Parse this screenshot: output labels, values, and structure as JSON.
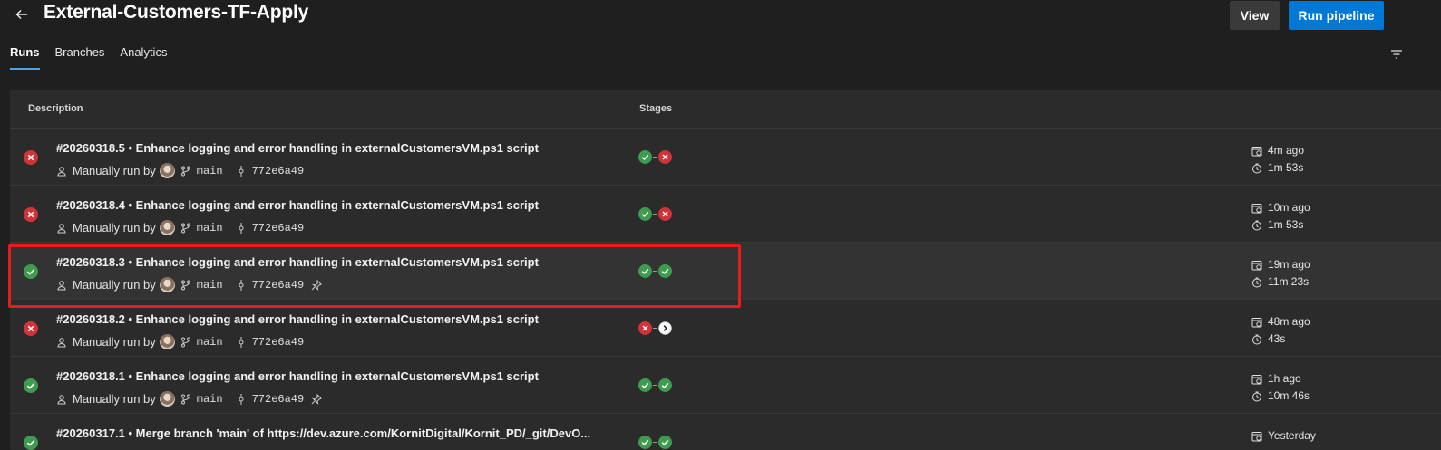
{
  "header": {
    "title": "External-Customers-TF-Apply",
    "view_label": "View",
    "run_label": "Run pipeline"
  },
  "tabs": [
    {
      "label": "Runs"
    },
    {
      "label": "Branches"
    },
    {
      "label": "Analytics"
    }
  ],
  "table": {
    "col_description": "Description",
    "col_stages": "Stages"
  },
  "runs": [
    {
      "status": "failed",
      "description": "#20260318.5 • Enhance logging and error handling in externalCustomersVM.ps1 script",
      "trigger": "Manually run by",
      "branch": "main",
      "commit": "772e6a49",
      "pinned": false,
      "stages": [
        "success",
        "failed"
      ],
      "started": "4m ago",
      "duration": "1m 53s"
    },
    {
      "status": "failed",
      "description": "#20260318.4 • Enhance logging and error handling in externalCustomersVM.ps1 script",
      "trigger": "Manually run by",
      "branch": "main",
      "commit": "772e6a49",
      "pinned": false,
      "stages": [
        "success",
        "failed"
      ],
      "started": "10m ago",
      "duration": "1m 53s"
    },
    {
      "status": "success",
      "description": "#20260318.3 • Enhance logging and error handling in externalCustomersVM.ps1 script",
      "trigger": "Manually run by",
      "branch": "main",
      "commit": "772e6a49",
      "pinned": true,
      "stages": [
        "success",
        "success"
      ],
      "started": "19m ago",
      "duration": "11m 23s"
    },
    {
      "status": "failed",
      "description": "#20260318.2 • Enhance logging and error handling in externalCustomersVM.ps1 script",
      "trigger": "Manually run by",
      "branch": "main",
      "commit": "772e6a49",
      "pinned": false,
      "stages": [
        "failed",
        "skipped"
      ],
      "started": "48m ago",
      "duration": "43s"
    },
    {
      "status": "success",
      "description": "#20260318.1 • Enhance logging and error handling in externalCustomersVM.ps1 script",
      "trigger": "Manually run by",
      "branch": "main",
      "commit": "772e6a49",
      "pinned": true,
      "stages": [
        "success",
        "success"
      ],
      "started": "1h ago",
      "duration": "10m 46s"
    },
    {
      "status": "success",
      "description": "#20260317.1 • Merge branch 'main' of https://dev.azure.com/KornitDigital/Kornit_PD/_git/DevO...",
      "trigger": "",
      "branch": "",
      "commit": "",
      "pinned": false,
      "stages": [
        "success",
        "success"
      ],
      "started": "Yesterday",
      "duration": ""
    }
  ],
  "colors": {
    "accent": "#0078d4",
    "success": "#3f9b4f",
    "failed": "#d13438",
    "highlight_box": "#e81c1c"
  }
}
